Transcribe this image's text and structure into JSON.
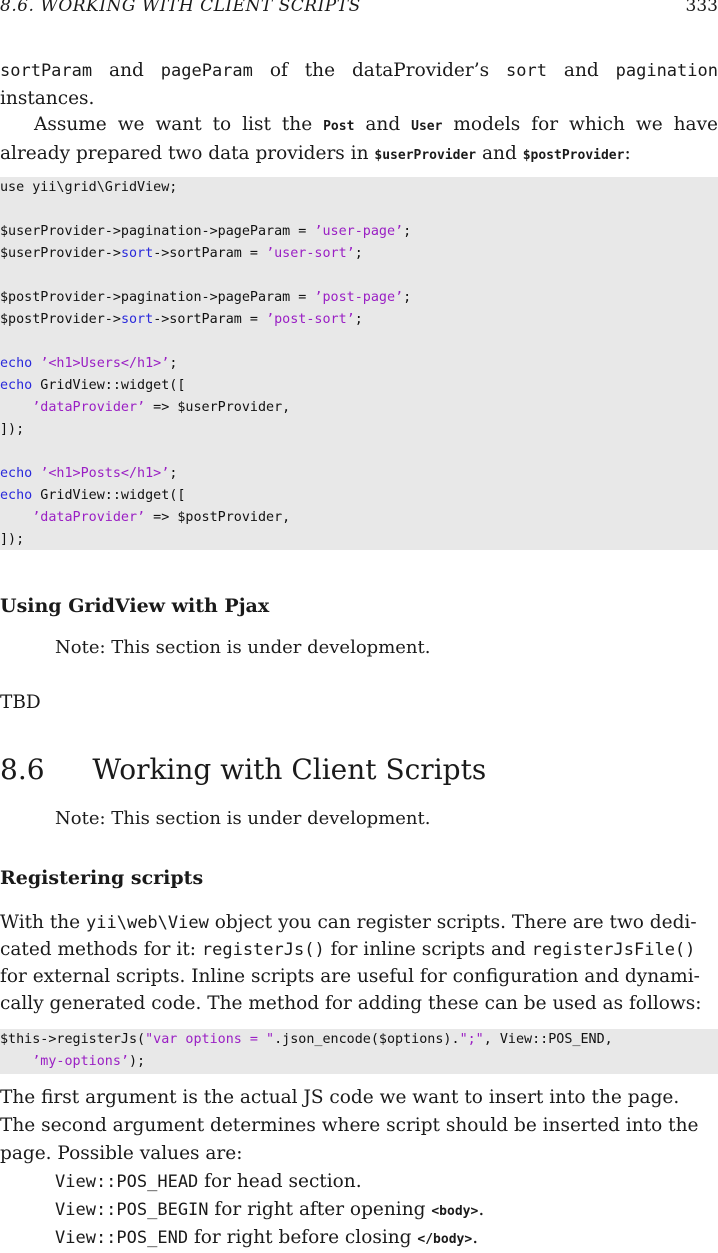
{
  "header": {
    "title": "8.6.   WORKING WITH CLIENT SCRIPTS",
    "page_number": "333"
  },
  "intro": {
    "p1": [
      {
        "t": "sortParam",
        "code": true
      },
      {
        "t": " and "
      },
      {
        "t": "pageParam",
        "code": true
      },
      {
        "t": " of the dataProvider’s "
      },
      {
        "t": "sort",
        "code": true
      },
      {
        "t": " and "
      },
      {
        "t": "pagination",
        "code": true
      },
      {
        "t": " instances."
      }
    ],
    "p2": [
      {
        "t": "Assume we want to list the "
      },
      {
        "t": "Post",
        "small": true
      },
      {
        "t": " and "
      },
      {
        "t": "User",
        "small": true
      },
      {
        "t": " models for which we have already prepared two data providers in "
      },
      {
        "t": "$userProvider",
        "small": true
      },
      {
        "t": " and "
      },
      {
        "t": "$postProvider",
        "small": true
      },
      {
        "t": ":"
      }
    ]
  },
  "code1": [
    [
      {
        "t": "use yii\\grid\\GridView;"
      }
    ],
    [],
    [
      {
        "t": "$userProvider->pagination->pageParam = "
      },
      {
        "t": "’user-page’",
        "s": "str"
      },
      {
        "t": ";"
      }
    ],
    [
      {
        "t": "$userProvider->"
      },
      {
        "t": "sort",
        "s": "kw"
      },
      {
        "t": "->sortParam = "
      },
      {
        "t": "’user-sort’",
        "s": "str"
      },
      {
        "t": ";"
      }
    ],
    [],
    [
      {
        "t": "$postProvider->pagination->pageParam = "
      },
      {
        "t": "’post-page’",
        "s": "str"
      },
      {
        "t": ";"
      }
    ],
    [
      {
        "t": "$postProvider->"
      },
      {
        "t": "sort",
        "s": "kw"
      },
      {
        "t": "->sortParam = "
      },
      {
        "t": "’post-sort’",
        "s": "str"
      },
      {
        "t": ";"
      }
    ],
    [],
    [
      {
        "t": "echo",
        "s": "kw"
      },
      {
        "t": " "
      },
      {
        "t": "’<h1>Users</h1>’",
        "s": "str"
      },
      {
        "t": ";"
      }
    ],
    [
      {
        "t": "echo",
        "s": "kw"
      },
      {
        "t": " GridView::widget(["
      }
    ],
    [
      {
        "t": "    "
      },
      {
        "t": "’dataProvider’",
        "s": "str"
      },
      {
        "t": " => $userProvider,"
      }
    ],
    [
      {
        "t": "]);"
      }
    ],
    [],
    [
      {
        "t": "echo",
        "s": "kw"
      },
      {
        "t": " "
      },
      {
        "t": "’<h1>Posts</h1>’",
        "s": "str"
      },
      {
        "t": ";"
      }
    ],
    [
      {
        "t": "echo",
        "s": "kw"
      },
      {
        "t": " GridView::widget(["
      }
    ],
    [
      {
        "t": "    "
      },
      {
        "t": "’dataProvider’",
        "s": "str"
      },
      {
        "t": " => $postProvider,"
      }
    ],
    [
      {
        "t": "]);"
      }
    ]
  ],
  "pjax": {
    "heading": "Using GridView with Pjax",
    "note": "Note: This section is under development.",
    "tbd": "TBD"
  },
  "section": {
    "number": "8.6",
    "title": "Working with Client Scripts",
    "note": "Note: This section is under development."
  },
  "registering": {
    "heading": "Registering scripts",
    "lines": [
      [
        {
          "t": "With the "
        },
        {
          "t": "yii\\web\\View",
          "code": true
        },
        {
          "t": " object you can register scripts. There are two dedi-"
        }
      ],
      [
        {
          "t": "cated methods for it: "
        },
        {
          "t": "registerJs()",
          "code": true
        },
        {
          "t": " for inline scripts and "
        },
        {
          "t": "registerJsFile()",
          "code": true
        }
      ],
      [
        {
          "t": "for external scripts. Inline scripts are useful for configuration and dynami-"
        }
      ],
      [
        {
          "t": "cally generated code. The method for adding these can be used as follows:"
        }
      ]
    ]
  },
  "code2": [
    [
      {
        "t": "$this->registerJs("
      },
      {
        "t": "\"var options = \"",
        "s": "str"
      },
      {
        "t": ".json_encode($options)."
      },
      {
        "t": "\";\"",
        "s": "str"
      },
      {
        "t": ", View::POS_END,"
      }
    ],
    [
      {
        "t": "    "
      },
      {
        "t": "’my-options’",
        "s": "str"
      },
      {
        "t": ");"
      }
    ]
  ],
  "after": {
    "lines": [
      [
        {
          "t": "The first argument is the actual JS code we want to insert into the page."
        }
      ],
      [
        {
          "t": "The second argument determines where script should be inserted into the"
        }
      ],
      [
        {
          "t": "page. Possible values are:"
        }
      ]
    ],
    "items": [
      [
        {
          "t": "View::POS_HEAD",
          "code": true
        },
        {
          "t": " for head section."
        }
      ],
      [
        {
          "t": "View::POS_BEGIN",
          "code": true
        },
        {
          "t": " for right after opening "
        },
        {
          "t": "<body>",
          "small": true
        },
        {
          "t": "."
        }
      ],
      [
        {
          "t": "View::POS_END",
          "code": true
        },
        {
          "t": " for right before closing "
        },
        {
          "t": "</body>",
          "small": true
        },
        {
          "t": "."
        }
      ]
    ]
  }
}
